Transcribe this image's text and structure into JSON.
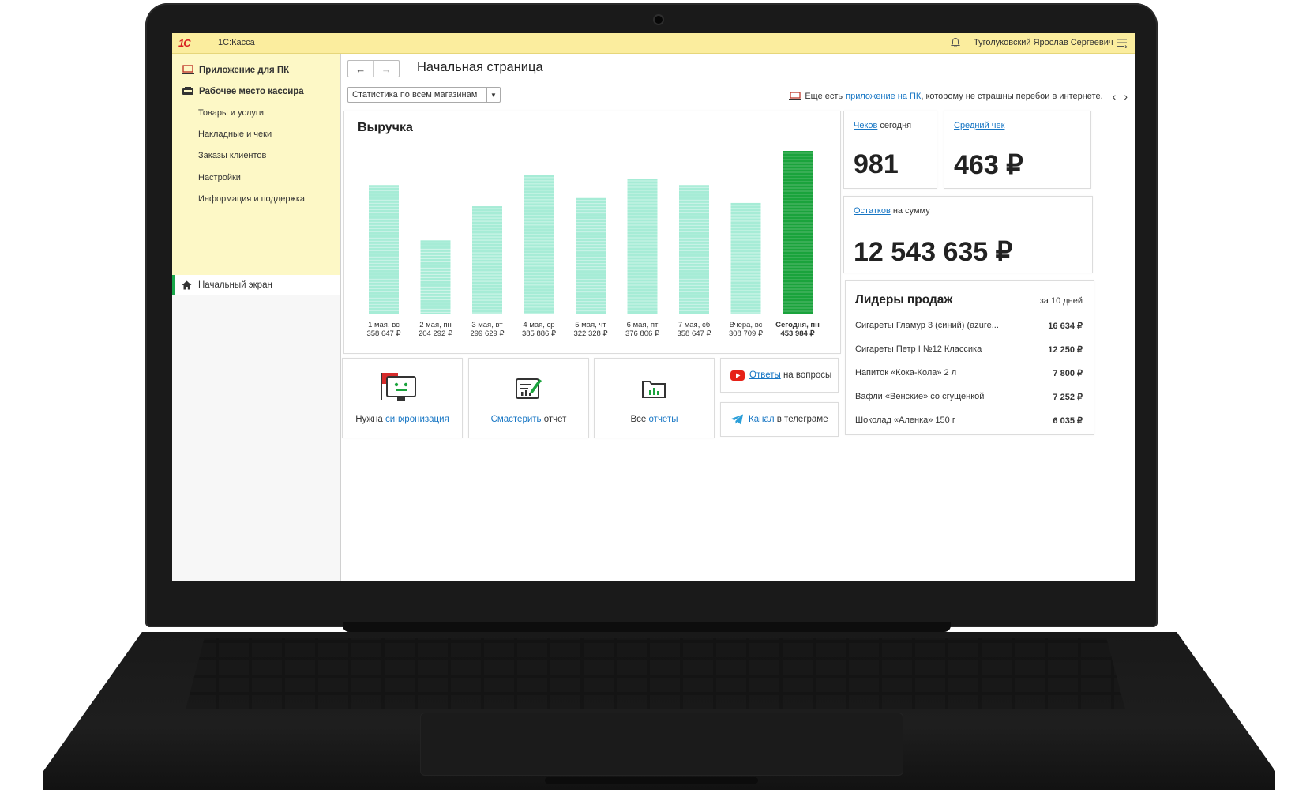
{
  "app": {
    "title": "1С:Касса",
    "logo": "1С",
    "user": "Туголуковский Ярослав Сергеевич"
  },
  "sidebar": {
    "items": [
      {
        "label": "Приложение для ПК",
        "icon": "laptop-icon"
      },
      {
        "label": "Рабочее место кассира",
        "icon": "cash-register-icon"
      }
    ],
    "subitems": [
      {
        "label": "Товары и услуги"
      },
      {
        "label": "Накладные и чеки"
      },
      {
        "label": "Заказы клиентов"
      },
      {
        "label": "Настройки"
      },
      {
        "label": "Информация и поддержка"
      }
    ],
    "home": {
      "label": "Начальный экран",
      "icon": "home-icon"
    }
  },
  "header": {
    "title": "Начальная страница",
    "back_icon": "arrow-left-icon",
    "forward_icon": "arrow-right-icon"
  },
  "filter": {
    "store_select": "Статистика по всем магазинам"
  },
  "promo": {
    "prefix": "Еще есть",
    "link": "приложение на ПК",
    "suffix": ", которому не страшны перебои в интернете."
  },
  "revenue": {
    "title": "Выручка"
  },
  "chart_data": {
    "type": "bar",
    "title": "Выручка",
    "categories": [
      "1 мая, вс",
      "2 мая, пн",
      "3 мая, вт",
      "4 мая, ср",
      "5 мая, чт",
      "6 мая, пт",
      "7 мая, сб",
      "Вчера, вс",
      "Сегодня, пн"
    ],
    "value_labels": [
      "358 647 ₽",
      "204 292 ₽",
      "299 629 ₽",
      "385 886 ₽",
      "322 328 ₽",
      "376 806 ₽",
      "358 647 ₽",
      "308 709 ₽",
      "453 984 ₽"
    ],
    "values": [
      358647,
      204292,
      299629,
      385886,
      322328,
      376806,
      358647,
      308709,
      453984
    ],
    "highlight_index": 8,
    "colors": {
      "normal": "#a6ecd6",
      "highlight": "#1aa33c"
    },
    "ylim": [
      0,
      453984
    ],
    "grid": false
  },
  "kpis": {
    "checks": {
      "link": "Чеков",
      "suffix": " сегодня",
      "value": "981"
    },
    "avg": {
      "link": "Средний чек",
      "value": "463 ₽"
    },
    "stock": {
      "link": "Остатков",
      "suffix": " на сумму",
      "value": "12 543 635 ₽"
    }
  },
  "leaders": {
    "title": "Лидеры продаж",
    "period": "за 10 дней",
    "rows": [
      {
        "name": "Сигареты Гламур 3 (синий) (azure...",
        "value": "16 634 ₽"
      },
      {
        "name": "Сигареты Петр I №12 Классика",
        "value": "12 250 ₽"
      },
      {
        "name": "Напиток «Кока-Кола» 2 л",
        "value": "7 800 ₽"
      },
      {
        "name": "Вафли «Венские» со сгущенкой",
        "value": "7 252 ₽"
      },
      {
        "name": "Шоколад «Аленка» 150 г",
        "value": "6 035 ₽"
      }
    ]
  },
  "tiles": {
    "sync": {
      "prefix": "Нужна ",
      "link": "синхронизация",
      "icon": "sync-robot-icon"
    },
    "report": {
      "link": "Смастерить",
      "suffix": " отчет",
      "icon": "report-builder-icon"
    },
    "reports": {
      "prefix": "Все ",
      "link": "отчеты",
      "icon": "reports-folder-icon"
    },
    "answers": {
      "link": "Ответы",
      "suffix": " на вопросы",
      "icon": "youtube-icon"
    },
    "channel": {
      "link": "Канал",
      "suffix": " в телеграме",
      "icon": "telegram-icon"
    }
  }
}
